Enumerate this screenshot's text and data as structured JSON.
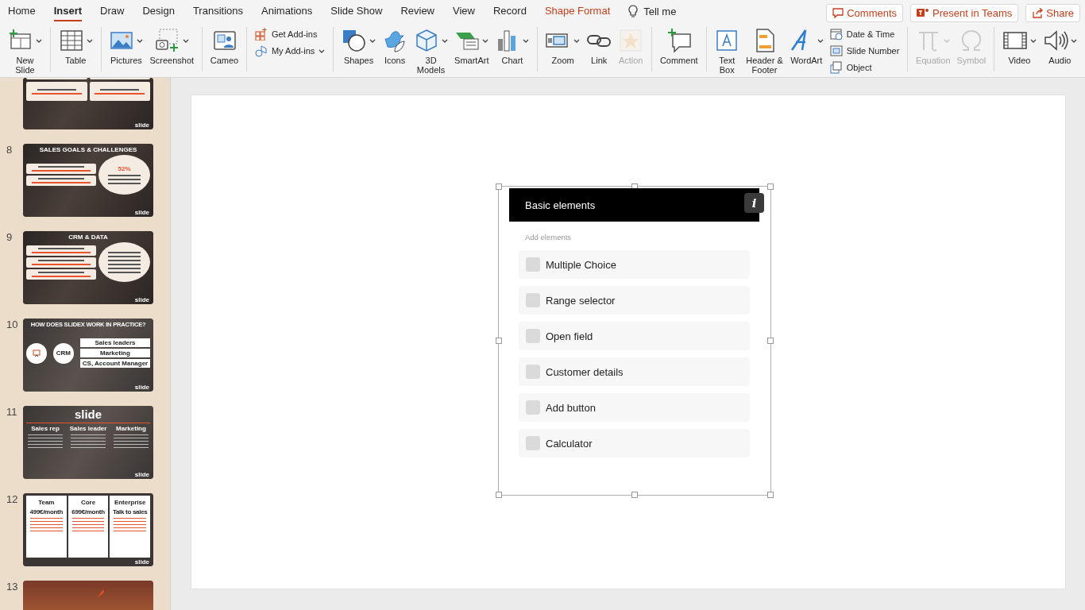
{
  "menu_tabs": [
    {
      "label": "Home",
      "kind": "tab",
      "selected": false
    },
    {
      "label": "Insert",
      "kind": "tab",
      "selected": true
    },
    {
      "label": "Draw",
      "kind": "tab",
      "selected": false
    },
    {
      "label": "Design",
      "kind": "tab",
      "selected": false
    },
    {
      "label": "Transitions",
      "kind": "tab",
      "selected": false
    },
    {
      "label": "Animations",
      "kind": "tab",
      "selected": false
    },
    {
      "label": "Slide Show",
      "kind": "tab",
      "selected": false
    },
    {
      "label": "Review",
      "kind": "tab",
      "selected": false
    },
    {
      "label": "View",
      "kind": "tab",
      "selected": false
    },
    {
      "label": "Record",
      "kind": "tab",
      "selected": false
    },
    {
      "label": "Shape Format",
      "kind": "contextual",
      "selected": false
    }
  ],
  "tell_me": "Tell me",
  "header_buttons": [
    {
      "label": "Comments"
    },
    {
      "label": "Present in Teams"
    },
    {
      "label": "Share"
    }
  ],
  "ribbon": {
    "groups": [
      {
        "items": [
          {
            "label": "New\nSlide",
            "kind": "large",
            "dropdown": true,
            "disabled": false
          }
        ]
      },
      {
        "items": [
          {
            "label": "Table",
            "kind": "large",
            "dropdown": true,
            "disabled": false
          }
        ]
      },
      {
        "items": [
          {
            "label": "Pictures",
            "kind": "large",
            "dropdown": true,
            "disabled": false
          },
          {
            "label": "Screenshot",
            "kind": "large",
            "dropdown": true,
            "disabled": false
          }
        ]
      },
      {
        "items": [
          {
            "label": "Cameo",
            "kind": "large",
            "dropdown": false,
            "disabled": false
          }
        ]
      },
      {
        "items": [
          {
            "label": "Get Add-ins",
            "kind": "small",
            "dropdown": false,
            "disabled": false
          },
          {
            "label": "My Add-ins",
            "kind": "small",
            "dropdown": true,
            "disabled": false
          }
        ]
      },
      {
        "items": [
          {
            "label": "Shapes",
            "kind": "large",
            "dropdown": true,
            "disabled": false
          },
          {
            "label": "Icons",
            "kind": "large",
            "dropdown": false,
            "disabled": false
          },
          {
            "label": "3D\nModels",
            "kind": "large",
            "dropdown": true,
            "disabled": false
          },
          {
            "label": "SmartArt",
            "kind": "large",
            "dropdown": true,
            "disabled": false
          },
          {
            "label": "Chart",
            "kind": "large",
            "dropdown": true,
            "disabled": false
          }
        ]
      },
      {
        "items": [
          {
            "label": "Zoom",
            "kind": "large",
            "dropdown": true,
            "disabled": false
          },
          {
            "label": "Link",
            "kind": "large",
            "dropdown": false,
            "disabled": false
          },
          {
            "label": "Action",
            "kind": "large",
            "dropdown": false,
            "disabled": true
          }
        ]
      },
      {
        "items": [
          {
            "label": "Comment",
            "kind": "large",
            "dropdown": false,
            "disabled": false
          }
        ]
      },
      {
        "items": [
          {
            "label": "Text\nBox",
            "kind": "large",
            "dropdown": false,
            "disabled": false
          },
          {
            "label": "Header &\nFooter",
            "kind": "large",
            "dropdown": false,
            "disabled": false
          },
          {
            "label": "WordArt",
            "kind": "large",
            "dropdown": true,
            "disabled": false
          },
          {
            "label": "Date & Time",
            "kind": "small",
            "dropdown": false,
            "disabled": false
          },
          {
            "label": "Slide Number",
            "kind": "small",
            "dropdown": false,
            "disabled": false
          },
          {
            "label": "Object",
            "kind": "small",
            "dropdown": false,
            "disabled": false
          }
        ]
      },
      {
        "items": [
          {
            "label": "Equation",
            "kind": "large",
            "dropdown": true,
            "disabled": true
          },
          {
            "label": "Symbol",
            "kind": "large",
            "dropdown": false,
            "disabled": true
          }
        ]
      },
      {
        "items": [
          {
            "label": "Video",
            "kind": "large",
            "dropdown": true,
            "disabled": false
          },
          {
            "label": "Audio",
            "kind": "large",
            "dropdown": true,
            "disabled": false
          }
        ]
      }
    ]
  },
  "slides": [
    {
      "kind": "questions",
      "logo": "slide"
    },
    {
      "number": "8",
      "kind": "stat",
      "title": "SALES GOALS & CHALLENGES",
      "stat": "52%",
      "logo": "slide"
    },
    {
      "number": "9",
      "kind": "study",
      "title": "CRM & DATA",
      "logo": "slide"
    },
    {
      "number": "10",
      "kind": "diagram",
      "title": "HOW DOES SLIDEX WORK IN PRACTICE?",
      "hub": "CRM",
      "labels": [
        "Sales leaders",
        "Marketing",
        "CS, Account Manager"
      ],
      "logo": "slide"
    },
    {
      "number": "11",
      "kind": "columns",
      "brand": "slide",
      "columns": [
        "Sales rep",
        "Sales leader",
        "Marketing"
      ],
      "logo": "slide"
    },
    {
      "number": "12",
      "kind": "pricing",
      "plans": [
        {
          "name": "Team",
          "price": "499€/month"
        },
        {
          "name": "Core",
          "price": "699€/month"
        },
        {
          "name": "Enterprise",
          "price": "Talk to sales"
        }
      ],
      "logo": "slide"
    },
    {
      "number": "13",
      "kind": "cover"
    }
  ],
  "card": {
    "title": "Basic elements",
    "info": "i",
    "subtitle": "Add elements",
    "items": [
      "Multiple Choice",
      "Range selector",
      "Open field",
      "Customer details",
      "Add button",
      "Calculator"
    ]
  }
}
